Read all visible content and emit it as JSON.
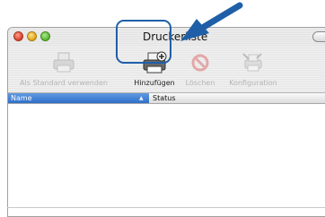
{
  "window": {
    "title": "Druckerliste"
  },
  "toolbar": {
    "items": [
      {
        "label": "Als Standard verwenden",
        "icon": "printer-default-icon",
        "enabled": false
      },
      {
        "label": "Hinzufügen",
        "icon": "add-printer-icon",
        "enabled": true
      },
      {
        "label": "Löschen",
        "icon": "delete-icon",
        "enabled": false
      },
      {
        "label": "Konfiguration",
        "icon": "configure-icon",
        "enabled": false
      }
    ]
  },
  "list": {
    "columns": [
      "Name",
      "Status"
    ],
    "sort_indicator": "▲",
    "rows": []
  },
  "colors": {
    "highlight": "#1f5fa8",
    "arrow": "#1f5fa8",
    "selected_header": "#3f7fd6"
  }
}
